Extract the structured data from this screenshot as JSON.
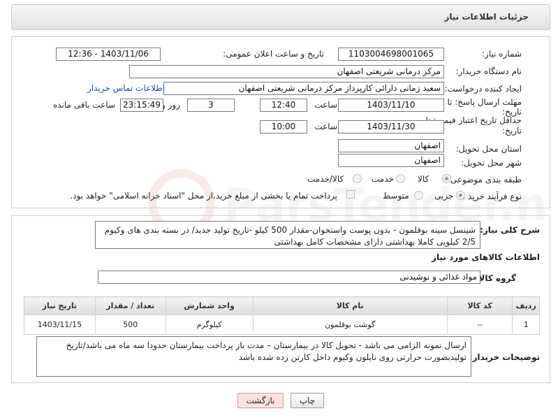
{
  "header": {
    "title": "جزئیات اطلاعات نیاز"
  },
  "form": {
    "need_number": {
      "label": "شماره نیاز:",
      "value": "1103004698001065"
    },
    "announce_datetime": {
      "label": "تاریخ و ساعت اعلان عمومی:",
      "value": "1403/11/06 - 12:36"
    },
    "buyer_org": {
      "label": "نام دستگاه خریدار:",
      "value": "مرکز درمانی شریعتی اصفهان"
    },
    "requester": {
      "label": "ایجاد کننده درخواست:",
      "value": "سعید زمانی دارائی کارپرداز مرکز درمانی شریعتی اصفهان",
      "contact_link": "اطلاعات تماس خریدار"
    },
    "reply_deadline": {
      "label_line1": "مهلت ارسال پاسخ: تا",
      "label_line2": "تاریخ:",
      "date": "1403/11/10",
      "time_label": "ساعت",
      "time": "12:40",
      "days": "3",
      "days_label": "روز و",
      "remaining": "23:15:49",
      "remaining_label": "ساعت باقی مانده"
    },
    "price_validity": {
      "label_line1": "حداقل تاریخ اعتبار قیمت: تا",
      "label_line2": "تاریخ:",
      "date": "1403/11/30",
      "time_label": "ساعت",
      "time": "10:00"
    },
    "delivery_province": {
      "label": "استان محل تحویل:",
      "value": "اصفهان"
    },
    "delivery_city": {
      "label": "شهر محل تحویل:",
      "value": "اصفهان"
    },
    "category": {
      "label": "طبقه بندی موضوعی:",
      "options": [
        "کالا",
        "خدمت",
        "کالا/خدمت"
      ],
      "selected": "کالا"
    },
    "process_type": {
      "label": "نوع فرآیند خرید :",
      "options": [
        "جزیی",
        "متوسط"
      ],
      "selected": "جزیی",
      "payment_note": "پرداخت تمام یا بخشی از مبلغ خرید،از محل \"اسناد خزانه اسلامی\" خواهد بود."
    }
  },
  "description": {
    "label": "شرح کلی نیاز:",
    "text": "شینسل سینه بوقلمون - بدون پوست واستخوان-مقدار 500 کیلو -تاریخ تولید جدید/ در بسته بندی های وکیوم 2/5  کیلویی کاملا بهداشتی دارای مشخصات کامل بهداشتی"
  },
  "goods": {
    "section_title": "اطلاعات کالاهای مورد نیاز",
    "group_label": "گروه کالا:",
    "group_value": "مواد غذائی و نوشیدنی",
    "columns": [
      "ردیف",
      "کد کالا",
      "نام کالا",
      "واحد شمارش",
      "تعداد / مقدار",
      "تاریخ نیاز"
    ],
    "rows": [
      [
        "1",
        "--",
        "گوشت بوقلمون",
        "کیلوگرم",
        "500",
        "1403/11/15"
      ]
    ]
  },
  "buyer_notes": {
    "label": "توضیحات خریدار:",
    "text": "ارسال نمونه الزامی می باشد - تحویل کالا در بیمارستان – مدت باز پرداخت بیمارستان حدودا سه ماه می باشد/تاریخ تولیدبصورت حرارتی روی نایلون وکیوم داخل کارتن زده شده باشد"
  },
  "buttons": {
    "print": "چاپ",
    "back": "بازگشت"
  },
  "colors": {
    "link": "#1a4fa0",
    "back_button": "#fbe3e3"
  }
}
